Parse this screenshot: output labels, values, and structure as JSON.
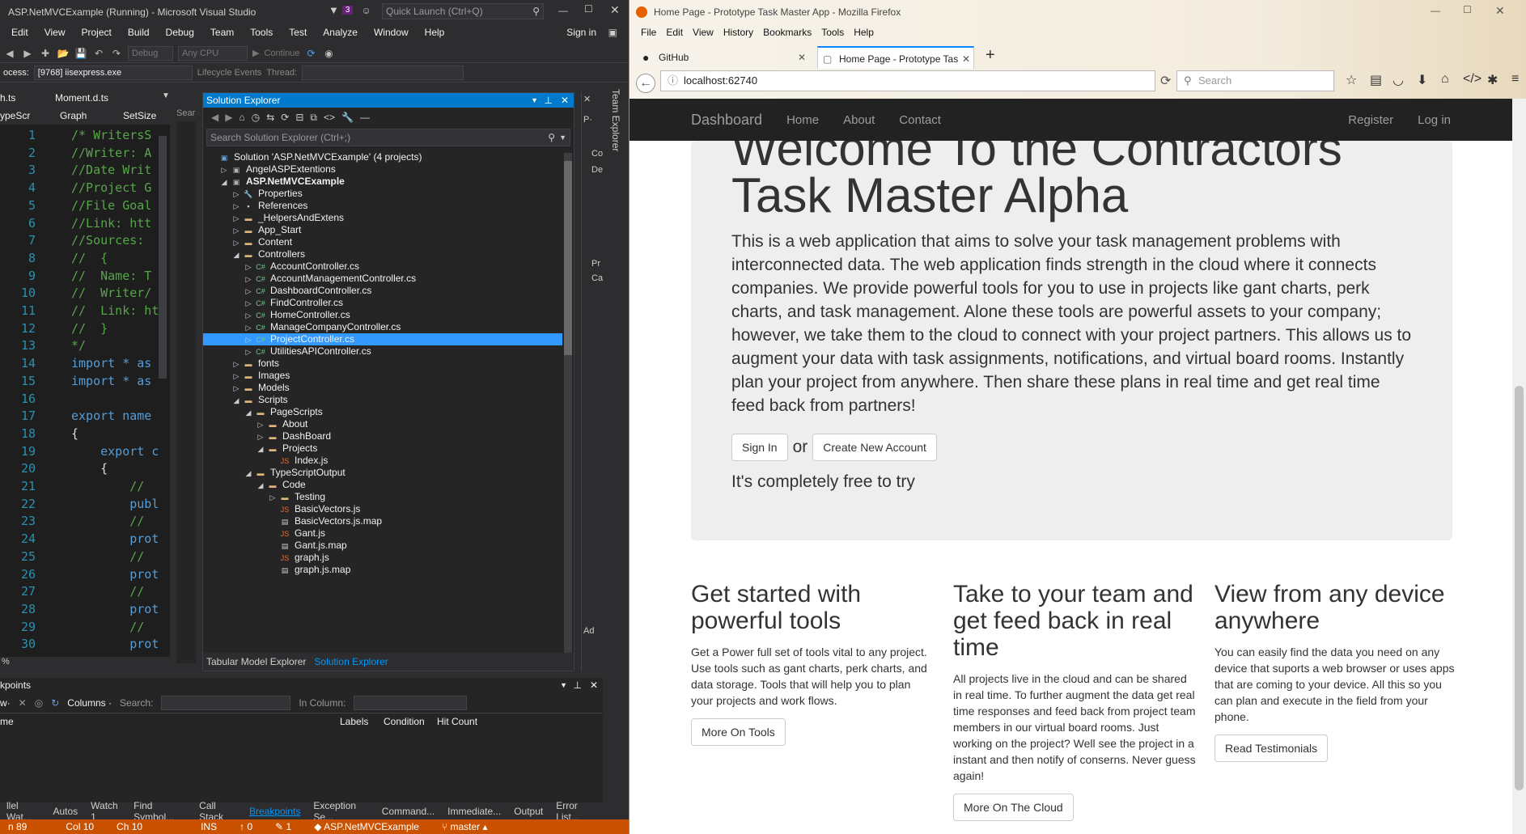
{
  "vs": {
    "title": "ASP.NetMVCExample (Running) - Microsoft Visual Studio",
    "notification_count": "3",
    "quick_launch_placeholder": "Quick Launch (Ctrl+Q)",
    "sign_in": "Sign in",
    "menu": [
      "Edit",
      "View",
      "Project",
      "Build",
      "Debug",
      "Team",
      "Tools",
      "Test",
      "Analyze",
      "Window",
      "Help"
    ],
    "toolbar": {
      "config": "Debug",
      "platform": "Any CPU",
      "continue": "Continue"
    },
    "process_label": "ocess:",
    "process_value": "[9768] iisexpress.exe",
    "lifecycle": "Lifecycle Events",
    "thread_label": "Thread:",
    "doc_tabs": [
      "h.ts",
      "Moment.d.ts"
    ],
    "nav_combo": [
      "ypeScr",
      "Graph",
      "SetSize",
      "Sear"
    ],
    "code_lines": [
      {
        "n": "1",
        "t": "/* WritersS",
        "c": "#57a64a"
      },
      {
        "n": "2",
        "t": "//Writer: A",
        "c": "#57a64a"
      },
      {
        "n": "3",
        "t": "//Date Writ",
        "c": "#57a64a"
      },
      {
        "n": "4",
        "t": "//Project G",
        "c": "#57a64a"
      },
      {
        "n": "5",
        "t": "//File Goal",
        "c": "#57a64a"
      },
      {
        "n": "6",
        "t": "//Link: htt",
        "c": "#57a64a"
      },
      {
        "n": "7",
        "t": "//Sources:",
        "c": "#57a64a"
      },
      {
        "n": "8",
        "t": "//  {",
        "c": "#57a64a"
      },
      {
        "n": "9",
        "t": "//  Name: T",
        "c": "#57a64a"
      },
      {
        "n": "10",
        "t": "//  Writer/",
        "c": "#57a64a"
      },
      {
        "n": "11",
        "t": "//  Link: ht",
        "c": "#57a64a"
      },
      {
        "n": "12",
        "t": "//  }",
        "c": "#57a64a"
      },
      {
        "n": "13",
        "t": "*/",
        "c": "#57a64a"
      },
      {
        "n": "14",
        "t": "import * as",
        "c": "#569cd6"
      },
      {
        "n": "15",
        "t": "import * as",
        "c": "#569cd6"
      },
      {
        "n": "16",
        "t": "",
        "c": "#dcdcdc"
      },
      {
        "n": "17",
        "t": "export name",
        "c": "#569cd6"
      },
      {
        "n": "18",
        "t": "{",
        "c": "#dcdcdc"
      },
      {
        "n": "19",
        "t": "    export c",
        "c": "#569cd6"
      },
      {
        "n": "20",
        "t": "    {",
        "c": "#dcdcdc"
      },
      {
        "n": "21",
        "t": "        //",
        "c": "#57a64a"
      },
      {
        "n": "22",
        "t": "        publ",
        "c": "#569cd6"
      },
      {
        "n": "23",
        "t": "        // ",
        "c": "#57a64a"
      },
      {
        "n": "24",
        "t": "        prot",
        "c": "#569cd6"
      },
      {
        "n": "25",
        "t": "        // ",
        "c": "#57a64a"
      },
      {
        "n": "26",
        "t": "        prot",
        "c": "#569cd6"
      },
      {
        "n": "27",
        "t": "        //",
        "c": "#57a64a"
      },
      {
        "n": "28",
        "t": "        prot",
        "c": "#569cd6"
      },
      {
        "n": "29",
        "t": "        //",
        "c": "#57a64a"
      },
      {
        "n": "30",
        "t": "        prot",
        "c": "#569cd6"
      }
    ],
    "zoom": "%",
    "solution_explorer": {
      "title": "Solution Explorer",
      "search_placeholder": "Search Solution Explorer (Ctrl+;)",
      "items": [
        {
          "label": "Solution 'ASP.NetMVCExample' (4 projects)",
          "depth": 0,
          "arrow": "",
          "icon": "solution",
          "bold": false,
          "sel": false
        },
        {
          "label": "AngelASPExtentions",
          "depth": 1,
          "arrow": "▷",
          "icon": "project",
          "bold": false,
          "sel": false
        },
        {
          "label": "ASP.NetMVCExample",
          "depth": 1,
          "arrow": "◢",
          "icon": "project",
          "bold": true,
          "sel": false
        },
        {
          "label": "Properties",
          "depth": 2,
          "arrow": "▷",
          "icon": "wrench",
          "bold": false,
          "sel": false
        },
        {
          "label": "References",
          "depth": 2,
          "arrow": "▷",
          "icon": "refs",
          "bold": false,
          "sel": false
        },
        {
          "label": "_HelpersAndExtens",
          "depth": 2,
          "arrow": "▷",
          "icon": "folder",
          "bold": false,
          "sel": false
        },
        {
          "label": "App_Start",
          "depth": 2,
          "arrow": "▷",
          "icon": "folder",
          "bold": false,
          "sel": false
        },
        {
          "label": "Content",
          "depth": 2,
          "arrow": "▷",
          "icon": "folder",
          "bold": false,
          "sel": false
        },
        {
          "label": "Controllers",
          "depth": 2,
          "arrow": "◢",
          "icon": "folder",
          "bold": false,
          "sel": false
        },
        {
          "label": "AccountController.cs",
          "depth": 3,
          "arrow": "▷",
          "icon": "cs",
          "bold": false,
          "sel": false
        },
        {
          "label": "AccountManagementController.cs",
          "depth": 3,
          "arrow": "▷",
          "icon": "cs",
          "bold": false,
          "sel": false
        },
        {
          "label": "DashboardController.cs",
          "depth": 3,
          "arrow": "▷",
          "icon": "cs",
          "bold": false,
          "sel": false
        },
        {
          "label": "FindController.cs",
          "depth": 3,
          "arrow": "▷",
          "icon": "cs",
          "bold": false,
          "sel": false
        },
        {
          "label": "HomeController.cs",
          "depth": 3,
          "arrow": "▷",
          "icon": "cs",
          "bold": false,
          "sel": false
        },
        {
          "label": "ManageCompanyController.cs",
          "depth": 3,
          "arrow": "▷",
          "icon": "cs",
          "bold": false,
          "sel": false
        },
        {
          "label": "ProjectController.cs",
          "depth": 3,
          "arrow": "▷",
          "icon": "cs",
          "bold": false,
          "sel": true
        },
        {
          "label": "UtilitiesAPIController.cs",
          "depth": 3,
          "arrow": "▷",
          "icon": "cs",
          "bold": false,
          "sel": false
        },
        {
          "label": "fonts",
          "depth": 2,
          "arrow": "▷",
          "icon": "folder",
          "bold": false,
          "sel": false
        },
        {
          "label": "Images",
          "depth": 2,
          "arrow": "▷",
          "icon": "folder",
          "bold": false,
          "sel": false
        },
        {
          "label": "Models",
          "depth": 2,
          "arrow": "▷",
          "icon": "folder",
          "bold": false,
          "sel": false
        },
        {
          "label": "Scripts",
          "depth": 2,
          "arrow": "◢",
          "icon": "folder",
          "bold": false,
          "sel": false
        },
        {
          "label": "PageScripts",
          "depth": 3,
          "arrow": "◢",
          "icon": "folder",
          "bold": false,
          "sel": false
        },
        {
          "label": "About",
          "depth": 4,
          "arrow": "▷",
          "icon": "folder",
          "bold": false,
          "sel": false
        },
        {
          "label": "DashBoard",
          "depth": 4,
          "arrow": "▷",
          "icon": "folder",
          "bold": false,
          "sel": false
        },
        {
          "label": "Projects",
          "depth": 4,
          "arrow": "◢",
          "icon": "folder",
          "bold": false,
          "sel": false
        },
        {
          "label": "Index.js",
          "depth": 5,
          "arrow": "",
          "icon": "js",
          "bold": false,
          "sel": false
        },
        {
          "label": "TypeScriptOutput",
          "depth": 3,
          "arrow": "◢",
          "icon": "folder",
          "bold": false,
          "sel": false
        },
        {
          "label": "Code",
          "depth": 4,
          "arrow": "◢",
          "icon": "folder",
          "bold": false,
          "sel": false
        },
        {
          "label": "Testing",
          "depth": 5,
          "arrow": "▷",
          "icon": "folder",
          "bold": false,
          "sel": false
        },
        {
          "label": "BasicVectors.js",
          "depth": 5,
          "arrow": "",
          "icon": "js",
          "bold": false,
          "sel": false
        },
        {
          "label": "BasicVectors.js.map",
          "depth": 5,
          "arrow": "",
          "icon": "map",
          "bold": false,
          "sel": false
        },
        {
          "label": "Gant.js",
          "depth": 5,
          "arrow": "",
          "icon": "js",
          "bold": false,
          "sel": false
        },
        {
          "label": "Gant.js.map",
          "depth": 5,
          "arrow": "",
          "icon": "map",
          "bold": false,
          "sel": false
        },
        {
          "label": "graph.js",
          "depth": 5,
          "arrow": "",
          "icon": "js",
          "bold": false,
          "sel": false
        },
        {
          "label": "graph.js.map",
          "depth": 5,
          "arrow": "",
          "icon": "map",
          "bold": false,
          "sel": false
        }
      ],
      "bottom_tabs": [
        "Tabular Model Explorer",
        "Solution Explorer"
      ]
    },
    "right_strip": {
      "team_explorer": "Team Explorer",
      "p_label": "P·",
      "ad": "Ad",
      "co": "Co",
      "de": "De",
      "pr": "Pr",
      "ca": "Ca"
    },
    "breakpoints": {
      "title": "kpoints",
      "new_label": "w·",
      "columns": "Columns ·",
      "search_label": "Search:",
      "in_column_label": "In Column:",
      "headers": [
        "me",
        "Labels",
        "Condition",
        "Hit Count"
      ]
    },
    "bottom_tabs": [
      "llel Wat...",
      "Autos",
      "Watch 1",
      "Find Symbol...",
      "Call Stack",
      "Breakpoints",
      "Exception Se...",
      "Command...",
      "Immediate...",
      "Output",
      "Error List..."
    ],
    "status": {
      "ln": "n 89",
      "col": "Col 10",
      "ch": "Ch 10",
      "ins": "INS",
      "errors": "0",
      "pen": "1",
      "project": "ASP.NetMVCExample",
      "branch": "master"
    }
  },
  "ff": {
    "title": "Home Page - Prototype Task Master App - Mozilla Firefox",
    "menu": [
      "File",
      "Edit",
      "View",
      "History",
      "Bookmarks",
      "Tools",
      "Help"
    ],
    "tabs": [
      {
        "label": "GitHub",
        "active": false
      },
      {
        "label": "Home Page - Prototype Tas",
        "active": true
      }
    ],
    "url": "localhost:62740",
    "search_placeholder": "Search",
    "page": {
      "brand": "Dashboard",
      "nav": [
        "Home",
        "About",
        "Contact"
      ],
      "nav_right": [
        "Register",
        "Log in"
      ],
      "heading_top": "Welcome To the Contractors",
      "heading": "Task Master Alpha",
      "lead": "This is a web application that aims to solve your task management problems with interconnected data. The web application finds strength in the cloud where it connects companies. We provide powerful tools for you to use in projects like gant charts, perk charts, and task management. Alone these tools are powerful assets to your company; however, we take them to the cloud to connect with your project partners. This allows us to augment your data with task assignments, notifications, and virtual board rooms. Instantly plan your project from anywhere. Then share these plans in real time and get real time feed back from partners!",
      "sign_in": "Sign In",
      "or": "or",
      "create": "Create New Account",
      "free": "It's completely free to try",
      "cols": [
        {
          "h": "Get started with powerful tools",
          "p": "Get a Power full set of tools vital to any project. Use tools such as gant charts, perk charts, and data storage. Tools that will help you to plan your projects and work flows.",
          "btn": "More On Tools"
        },
        {
          "h": "Take to your team and get feed back in real time",
          "p": "All projects live in the cloud and can be shared in real time. To further augment the data get real time responses and feed back from project team members in our virtual board rooms. Just working on the project? Well see the project in a instant and then notify of conserns. Never guess again!",
          "btn": "More On The Cloud"
        },
        {
          "h": "View from any device anywhere",
          "p": "You can easily find the data you need on any device that suports a web browser or uses apps that are coming to your device. All this so you can plan and execute in the field from your phone.",
          "btn": "Read Testimonials"
        }
      ]
    }
  },
  "colors": {
    "vs_accent": "#007acc",
    "vs_status": "#ca5100",
    "selection": "#3399ff",
    "ff_navbar": "#222222",
    "jumbotron": "#eeeeee"
  }
}
